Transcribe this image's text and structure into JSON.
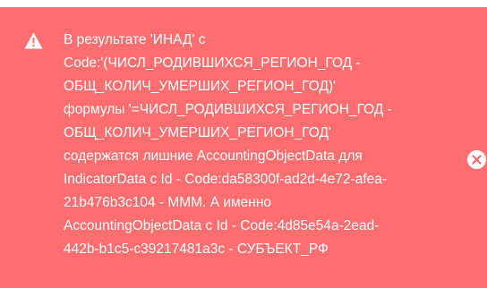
{
  "notification": {
    "type": "error",
    "background_color": "#fc6e6f",
    "icon": "warning-triangle-icon",
    "close_icon": "close-circle-icon",
    "message_lines": [
      "В результате 'ИНАД' с",
      "Code:'(ЧИСЛ_РОДИВШИХСЯ_РЕГИОН_ГОД -",
      "ОБЩ_КОЛИЧ_УМЕРШИХ_РЕГИОН_ГОД)'",
      "формулы '=ЧИСЛ_РОДИВШИХСЯ_РЕГИОН_ГОД -",
      "ОБЩ_КОЛИЧ_УМЕРШИХ_РЕГИОН_ГОД'",
      "содержатся лишние AccountingObjectData для",
      "IndicatorData с Id - Code:da58300f-ad2d-4e72-afea-",
      "21b476b3c104 - МММ. А именно",
      "AccountingObjectData с Id - Code:4d85e54a-2ead-",
      "442b-b1c5-c39217481a3c - СУБЪЕКТ_РФ"
    ]
  }
}
